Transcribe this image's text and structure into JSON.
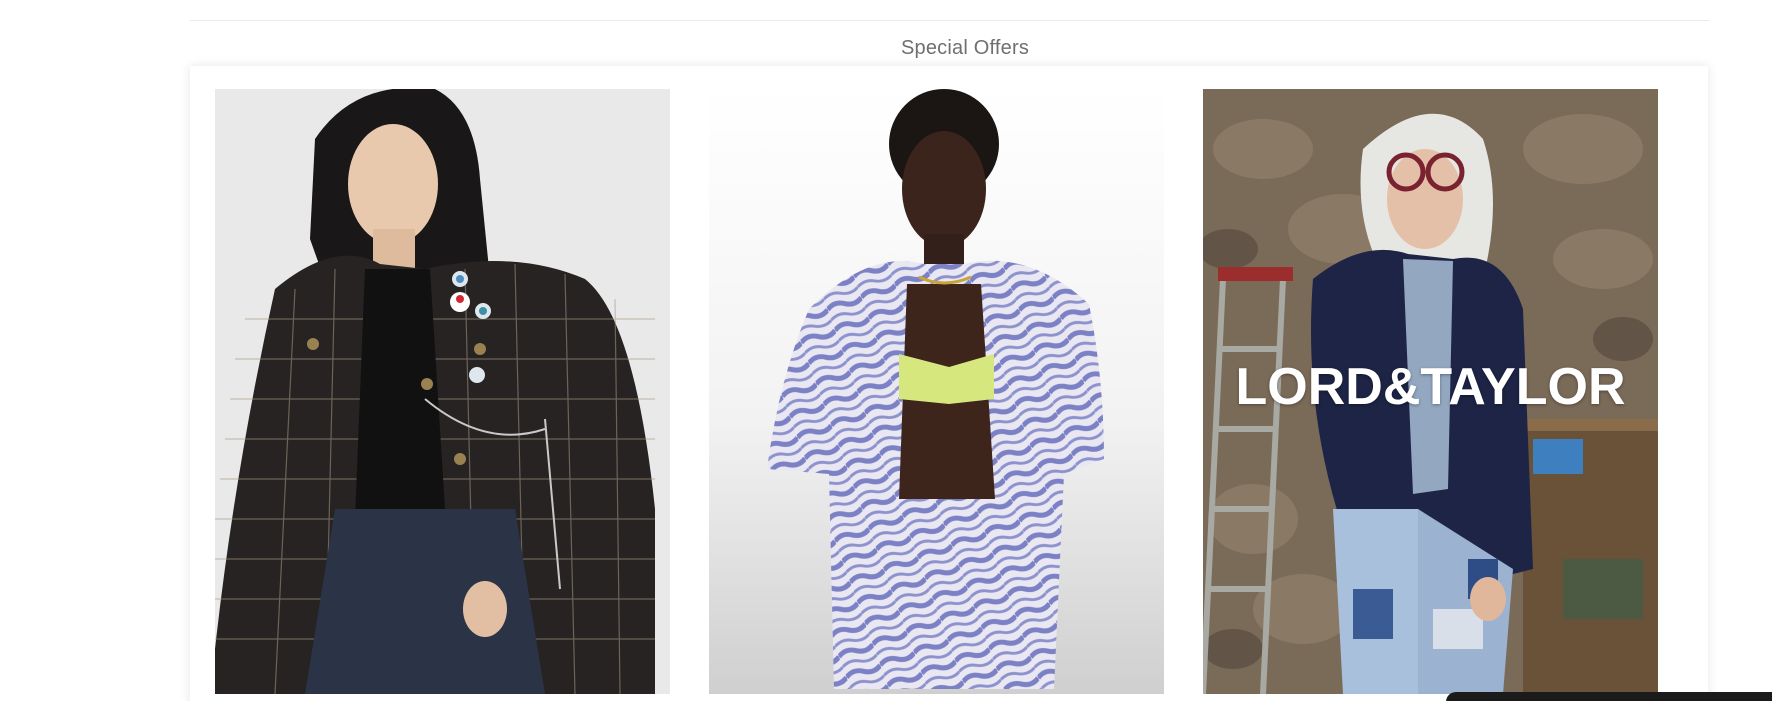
{
  "section": {
    "title": "Special Offers"
  },
  "offers": [
    {
      "name": "woman-tweed-jacket",
      "brand_text": ""
    },
    {
      "name": "woman-zebra-print-set",
      "brand_text": ""
    },
    {
      "name": "lord-and-taylor-campaign",
      "brand_text": "LORD&TAYLOR"
    }
  ],
  "colors": {
    "title_text": "#6f6f6f",
    "rule": "#ececec",
    "card_bg": "#ffffff"
  }
}
